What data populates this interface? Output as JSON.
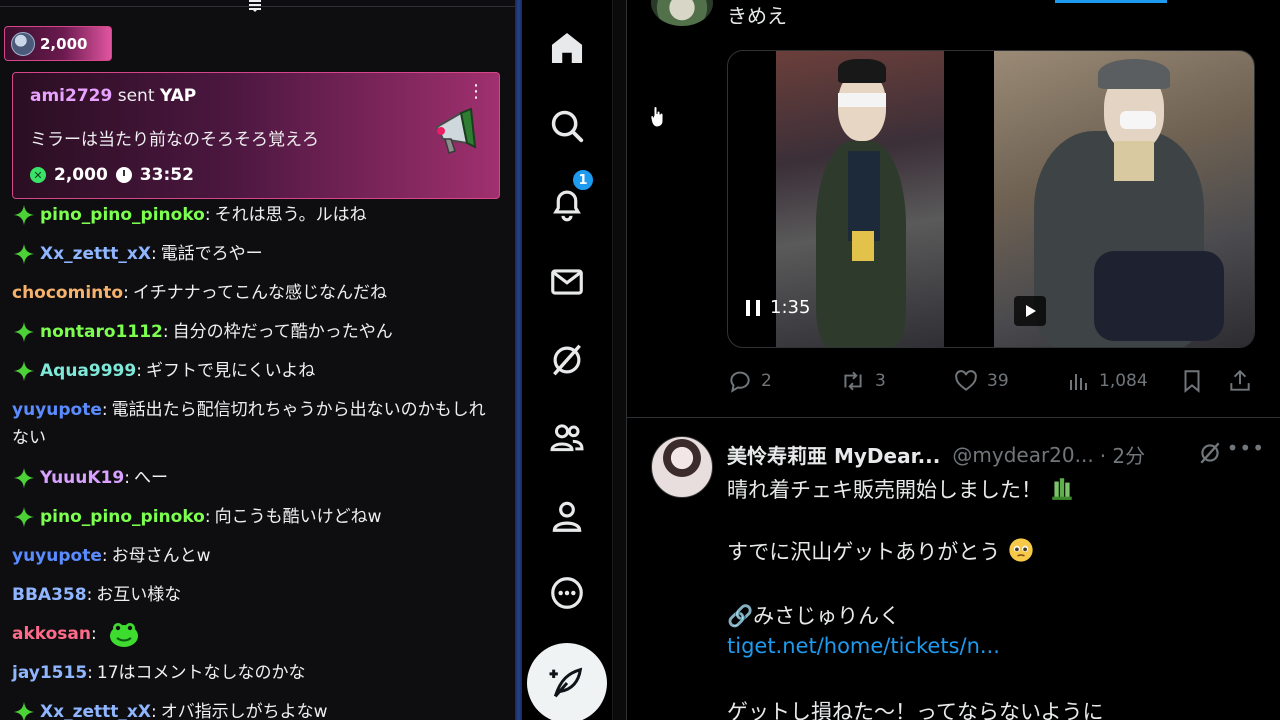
{
  "chat": {
    "bits_pill": {
      "amount": "2,000"
    },
    "yap_card": {
      "user": "ami2729",
      "sent": " sent ",
      "type": "YAP",
      "message": "ミラーは当たり前なのそろそろ覚えろ",
      "amount": "2,000",
      "timer": "33:52"
    },
    "messages": [
      {
        "badge": "sparkle",
        "user": "pino_pino_pinoko",
        "color": "#7cff4f",
        "text": "それは思う。ルはね"
      },
      {
        "badge": "sparkle",
        "user": "Xx_zettt_xX",
        "color": "#8fb6ff",
        "text": "電話でろやー"
      },
      {
        "badge": "",
        "user": "chocominto",
        "color": "#f6b26b",
        "text": "イチナナってこんな感じなんだね"
      },
      {
        "badge": "sparkle",
        "user": "nontaro1112",
        "color": "#7cff4f",
        "text": "自分の枠だって酷かったやん"
      },
      {
        "badge": "sparkle",
        "user": "Aqua9999",
        "color": "#7fe8d8",
        "text": "ギフトで見にくいよね"
      },
      {
        "badge": "",
        "user": "yuyupote",
        "color": "#5b8cff",
        "text": "電話出たら配信切れちゃうから出ないのかもしれない"
      },
      {
        "badge": "sparkle",
        "user": "YuuuK19",
        "color": "#d9a2ff",
        "text": "へー"
      },
      {
        "badge": "sparkle",
        "user": "pino_pino_pinoko",
        "color": "#7cff4f",
        "text": "向こうも酷いけどねw"
      },
      {
        "badge": "",
        "user": "yuyupote",
        "color": "#5b8cff",
        "text": "お母さんとw"
      },
      {
        "badge": "",
        "user": "BBA358",
        "color": "#8fb6ff",
        "text": "お互い様な"
      },
      {
        "badge": "",
        "user": "akkosan",
        "color": "#ff6b8a",
        "text": ""
      },
      {
        "badge": "",
        "user": "jay1515",
        "color": "#8fb6ff",
        "text": "17はコメントなしなのかな"
      },
      {
        "badge": "sparkle",
        "user": "Xx_zettt_xX",
        "color": "#8fb6ff",
        "text": "オバ指示しがちよなw"
      }
    ]
  },
  "nav": {
    "notifications_count": "1"
  },
  "feed": {
    "post1": {
      "text": "きめえ",
      "video_time": "1:35",
      "stats": {
        "replies": "2",
        "reposts": "3",
        "likes": "39",
        "views": "1,084"
      }
    },
    "post2": {
      "name": "美怜寿莉亜 MyDear...",
      "handle": "@mydear20...",
      "time": "· 2分",
      "line1": "晴れ着チェキ販売開始しました！",
      "line2": "すでに沢山ゲットありがとう",
      "line3": "🔗みさじゅりんく",
      "link": "tiget.net/home/tickets/n...",
      "line4": "ゲットし損ねた～！ってならないように"
    }
  },
  "colors": {
    "accent_blue": "#1d9bf0",
    "bits_pink": "#d4458a",
    "chat_bg": "#0e0e10",
    "muted": "#71767b"
  },
  "icons": [
    "menu-collapse-icon",
    "home-icon",
    "search-icon",
    "bell-icon",
    "mail-icon",
    "grok-icon",
    "communities-icon",
    "profile-icon",
    "more-icon",
    "compose-icon",
    "reply-icon",
    "repost-icon",
    "like-icon",
    "views-icon",
    "bookmark-icon",
    "share-icon",
    "pause-icon",
    "play-icon",
    "sparkle-badge-icon"
  ]
}
